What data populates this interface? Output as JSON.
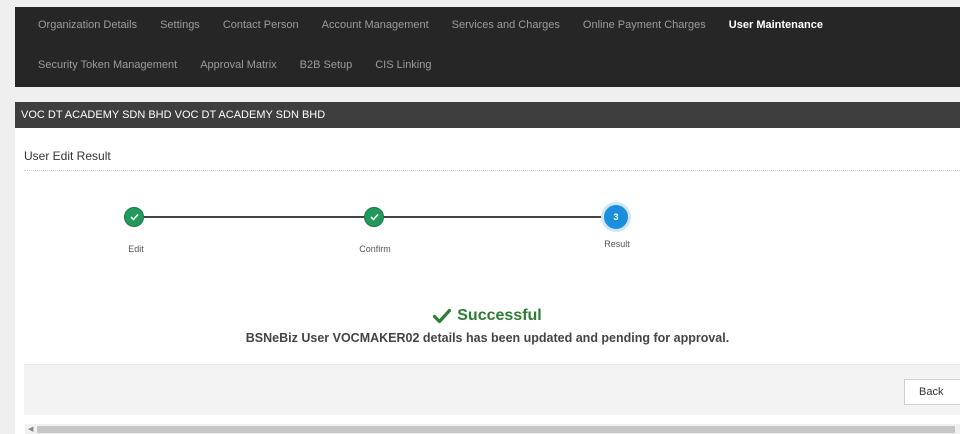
{
  "topnav": {
    "row1": [
      {
        "label": "Organization Details",
        "active": false
      },
      {
        "label": "Settings",
        "active": false
      },
      {
        "label": "Contact Person",
        "active": false
      },
      {
        "label": "Account Management",
        "active": false
      },
      {
        "label": "Services and Charges",
        "active": false
      },
      {
        "label": "Online Payment Charges",
        "active": false
      },
      {
        "label": "User Maintenance",
        "active": true
      }
    ],
    "row2": [
      {
        "label": "Security Token Management",
        "active": false
      },
      {
        "label": "Approval Matrix",
        "active": false
      },
      {
        "label": "B2B Setup",
        "active": false
      },
      {
        "label": "CIS Linking",
        "active": false
      }
    ]
  },
  "company_bar": "VOC DT ACADEMY SDN BHD VOC DT ACADEMY SDN BHD",
  "section_title": "User Edit Result",
  "steps": [
    {
      "label": "Edit",
      "state": "done"
    },
    {
      "label": "Confirm",
      "state": "done"
    },
    {
      "label": "Result",
      "state": "current",
      "number": "3"
    }
  ],
  "result": {
    "title": "Successful",
    "message": "BSNeBiz User VOCMAKER02 details has been updated and pending for approval."
  },
  "footer": {
    "back_label": "Back"
  },
  "colors": {
    "nav_bg": "#262626",
    "step_done": "#229a59",
    "step_current": "#1c8fdc",
    "success_text": "#2e7d32"
  }
}
